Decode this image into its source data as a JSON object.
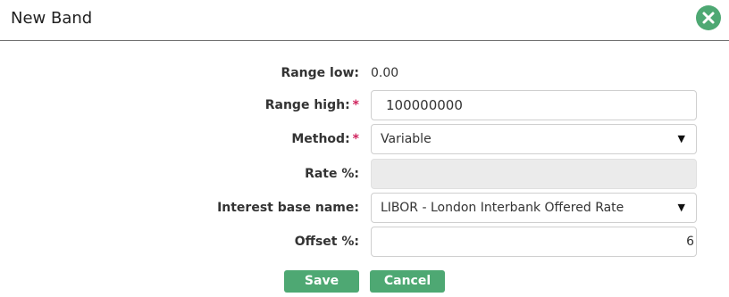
{
  "dialog": {
    "title": "New Band",
    "close_icon": "close-x-circle-icon"
  },
  "form": {
    "range_low": {
      "label": "Range low:",
      "value": "0.00"
    },
    "range_high": {
      "label": "Range high:",
      "required_marker": "*",
      "value": "100000000"
    },
    "method": {
      "label": "Method:",
      "required_marker": "*",
      "value": "Variable",
      "caret": "▼"
    },
    "rate": {
      "label": "Rate %:",
      "value": ""
    },
    "interest_base_name": {
      "label": "Interest base name:",
      "value": "LIBOR - London Interbank Offered Rate",
      "caret": "▼"
    },
    "offset": {
      "label": "Offset %:",
      "value": "6"
    }
  },
  "actions": {
    "save_label": "Save",
    "cancel_label": "Cancel"
  },
  "colors": {
    "accent": "#4ea873",
    "required": "#d0245e",
    "disabled_bg": "#ebebeb",
    "border": "#cfcfcf"
  }
}
